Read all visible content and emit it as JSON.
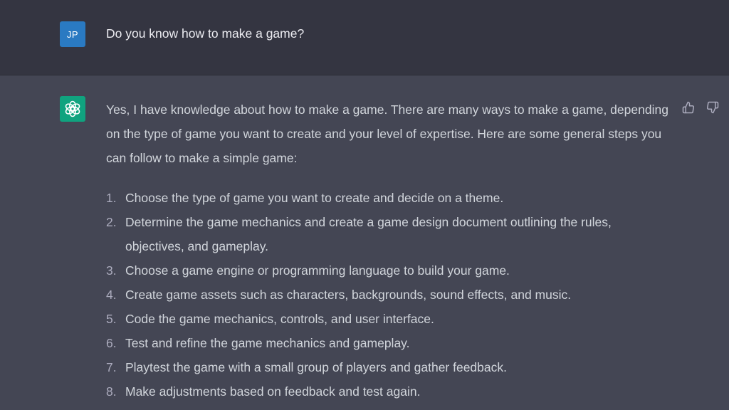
{
  "user_message": {
    "avatar_initials": "JP",
    "avatar_color": "#2a7ac2",
    "text": "Do you know how to make a game?"
  },
  "assistant_message": {
    "avatar_icon": "openai-logo-icon",
    "avatar_color": "#10a37f",
    "intro": "Yes, I have knowledge about how to make a game. There are many ways to make a game, depending on the type of game you want to create and your level of expertise. Here are some general steps you can follow to make a simple game:",
    "steps": [
      {
        "num": "1.",
        "text": "Choose the type of game you want to create and decide on a theme."
      },
      {
        "num": "2.",
        "text": "Determine the game mechanics and create a game design document outlining the rules, objectives, and gameplay."
      },
      {
        "num": "3.",
        "text": "Choose a game engine or programming language to build your game."
      },
      {
        "num": "4.",
        "text": "Create game assets such as characters, backgrounds, sound effects, and music."
      },
      {
        "num": "5.",
        "text": "Code the game mechanics, controls, and user interface."
      },
      {
        "num": "6.",
        "text": "Test and refine the game mechanics and gameplay."
      },
      {
        "num": "7.",
        "text": "Playtest the game with a small group of players and gather feedback."
      },
      {
        "num": "8.",
        "text": "Make adjustments based on feedback and test again."
      }
    ],
    "feedback_icons": [
      "thumbs-up-icon",
      "thumbs-down-icon"
    ]
  }
}
